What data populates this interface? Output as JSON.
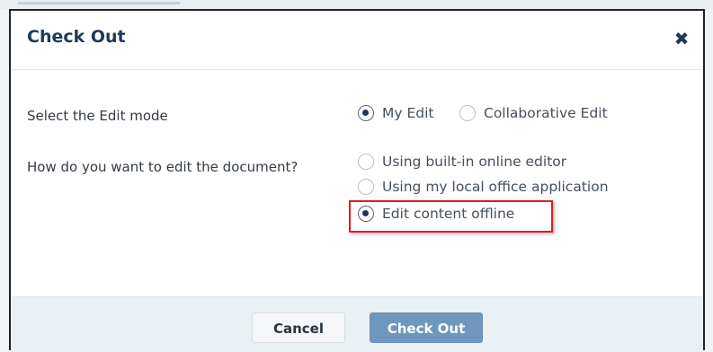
{
  "dialog": {
    "title": "Check Out",
    "close_icon": "close-icon"
  },
  "edit_mode": {
    "label": "Select the Edit mode",
    "options": [
      {
        "label": "My Edit",
        "checked": true
      },
      {
        "label": "Collaborative Edit",
        "checked": false
      }
    ]
  },
  "edit_method": {
    "label": "How do you want to edit the document?",
    "options": [
      {
        "label": "Using built-in online editor",
        "checked": false
      },
      {
        "label": "Using my local office application",
        "checked": false
      },
      {
        "label": "Edit content offline",
        "checked": true
      }
    ]
  },
  "footer": {
    "cancel_label": "Cancel",
    "checkout_label": "Check Out"
  },
  "colors": {
    "title": "#1e3a5a",
    "primary_button": "#6f97bd",
    "highlight": "#e31b23"
  }
}
